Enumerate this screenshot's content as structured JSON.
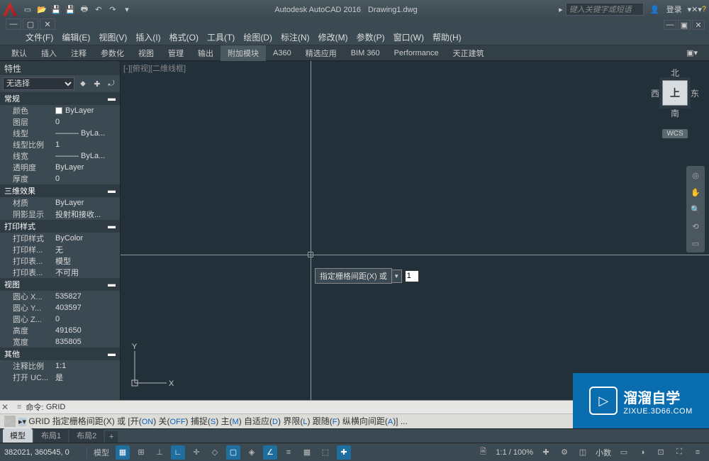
{
  "title": {
    "app": "Autodesk AutoCAD 2016",
    "doc": "Drawing1.dwg"
  },
  "search_placeholder": "键入关键字或短语",
  "login_label": "登录",
  "menubar": [
    "文件(F)",
    "编辑(E)",
    "视图(V)",
    "插入(I)",
    "格式(O)",
    "工具(T)",
    "绘图(D)",
    "标注(N)",
    "修改(M)",
    "参数(P)",
    "窗口(W)",
    "帮助(H)"
  ],
  "ribbon_tabs": [
    "默认",
    "插入",
    "注释",
    "参数化",
    "视图",
    "管理",
    "输出",
    "附加模块",
    "A360",
    "精选应用",
    "BIM 360",
    "Performance",
    "天正建筑"
  ],
  "ribbon_active": "附加模块",
  "properties": {
    "title": "特性",
    "selection": "无选择",
    "groups": [
      {
        "name": "常规",
        "rows": [
          {
            "k": "颜色",
            "v": "ByLayer",
            "swatch": true
          },
          {
            "k": "图层",
            "v": "0"
          },
          {
            "k": "线型",
            "v": "——— ByLa..."
          },
          {
            "k": "线型比例",
            "v": "1"
          },
          {
            "k": "线宽",
            "v": "——— ByLa..."
          },
          {
            "k": "透明度",
            "v": "ByLayer"
          },
          {
            "k": "厚度",
            "v": "0"
          }
        ]
      },
      {
        "name": "三维效果",
        "rows": [
          {
            "k": "材质",
            "v": "ByLayer"
          },
          {
            "k": "阴影显示",
            "v": "投射和接收..."
          }
        ]
      },
      {
        "name": "打印样式",
        "rows": [
          {
            "k": "打印样式",
            "v": "ByColor"
          },
          {
            "k": "打印样...",
            "v": "无"
          },
          {
            "k": "打印表...",
            "v": "模型"
          },
          {
            "k": "打印表...",
            "v": "不可用"
          }
        ]
      },
      {
        "name": "视图",
        "rows": [
          {
            "k": "圆心 X...",
            "v": "535827"
          },
          {
            "k": "圆心 Y...",
            "v": "403597"
          },
          {
            "k": "圆心 Z...",
            "v": "0"
          },
          {
            "k": "高度",
            "v": "491650"
          },
          {
            "k": "宽度",
            "v": "835805"
          }
        ]
      },
      {
        "name": "其他",
        "rows": [
          {
            "k": "注释比例",
            "v": "1:1"
          },
          {
            "k": "打开 UC...",
            "v": "是"
          }
        ]
      }
    ]
  },
  "viewport_label": "[-][俯视][二维线框]",
  "viewcube": {
    "n": "北",
    "s": "南",
    "e": "东",
    "w": "西",
    "face": "上",
    "wcs": "WCS"
  },
  "ucs": {
    "x": "X",
    "y": "Y"
  },
  "dynamic_input": {
    "label": "指定栅格间距(X) 或",
    "value": "1"
  },
  "command": {
    "history_prefix": "命令:",
    "history_cmd": "GRID",
    "prompt_head": "GRID 指定栅格间距(X)  或  [",
    "opts": [
      [
        "开",
        "ON"
      ],
      [
        "关",
        "OFF"
      ],
      [
        "捕捉",
        "S"
      ],
      [
        "主",
        "M"
      ],
      [
        "自适应",
        "D"
      ],
      [
        "界限",
        "L"
      ],
      [
        "跟随",
        "F"
      ],
      [
        "纵横向间距",
        "A"
      ]
    ],
    "prompt_tail": "] ..."
  },
  "layout_tabs": [
    "模型",
    "布局1",
    "布局2"
  ],
  "status": {
    "coords": "382021, 360545, 0",
    "model": "模型",
    "scale": "1:1 / 100%",
    "decimal": "小数"
  },
  "watermark": {
    "l1": "溜溜自学",
    "l2": "ZIXUE.3D66.COM"
  }
}
